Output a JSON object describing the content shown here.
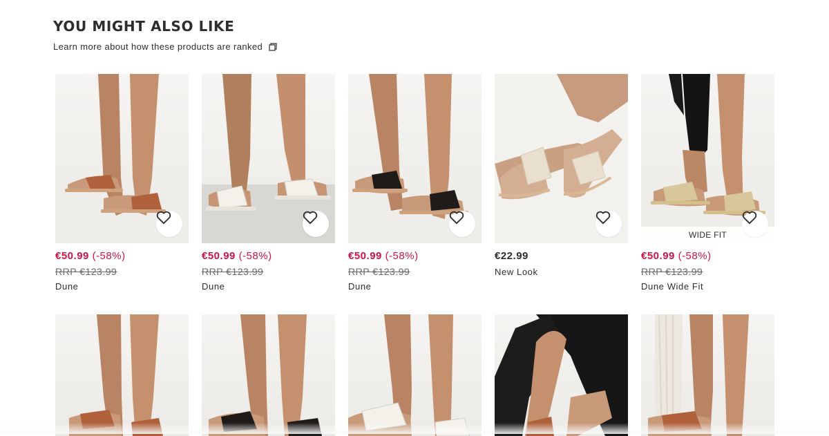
{
  "section": {
    "title": "YOU MIGHT ALSO LIKE",
    "ranked_link": "Learn more about how these products are ranked"
  },
  "products_row1": [
    {
      "price": "€50.99",
      "discount": "(-58%)",
      "rrp": "RRP €123.99",
      "brand": "Dune",
      "on_sale": true,
      "sandal_color": "#b0603a"
    },
    {
      "price": "€50.99",
      "discount": "(-58%)",
      "rrp": "RRP €123.99",
      "brand": "Dune",
      "on_sale": true,
      "sandal_color": "#f4f1ea"
    },
    {
      "price": "€50.99",
      "discount": "(-58%)",
      "rrp": "RRP €123.99",
      "brand": "Dune",
      "on_sale": true,
      "sandal_color": "#1e1b19"
    },
    {
      "price": "€22.99",
      "brand": "New Look",
      "on_sale": false,
      "sandal_color": "#e8dfcf"
    },
    {
      "price": "€50.99",
      "discount": "(-58%)",
      "rrp": "RRP €123.99",
      "brand": "Dune Wide Fit",
      "on_sale": true,
      "badge": "WIDE FIT",
      "sandal_color": "#d8c79a"
    }
  ],
  "products_row2": [
    {
      "sandal_color": "#b0603a"
    },
    {
      "sandal_color": "#1e1b19"
    },
    {
      "sandal_color": "#f4f1ea"
    },
    {
      "sandal_color": "#b0603a"
    },
    {
      "sandal_color": "#b0603a"
    }
  ],
  "colors": {
    "sale": "#d01345",
    "text": "#2d2d2d",
    "muted": "#666666"
  },
  "icons": {
    "heart": "heart-icon",
    "ranked": "copy-icon"
  }
}
